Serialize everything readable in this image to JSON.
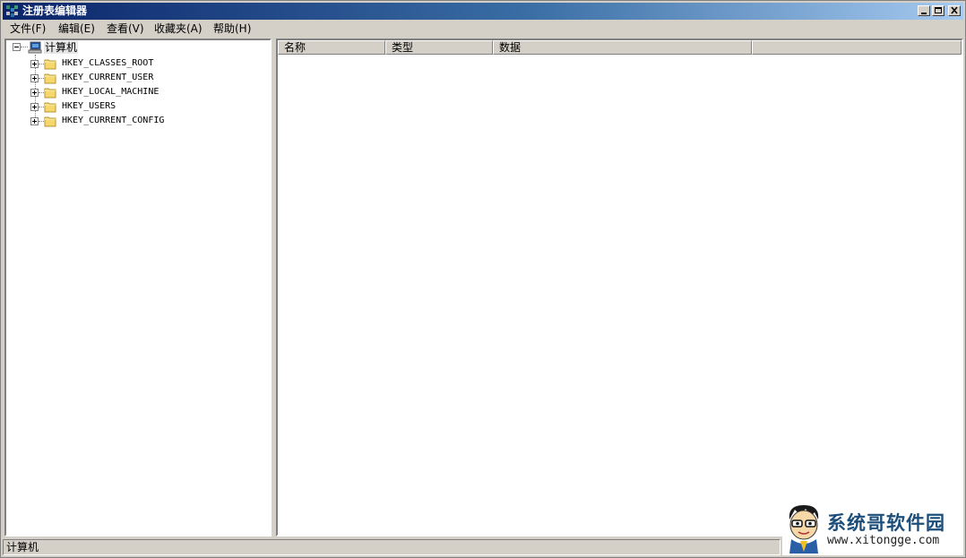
{
  "window": {
    "title": "注册表编辑器"
  },
  "menu": [
    {
      "label": "文件(F)"
    },
    {
      "label": "编辑(E)"
    },
    {
      "label": "查看(V)"
    },
    {
      "label": "收藏夹(A)"
    },
    {
      "label": "帮助(H)"
    }
  ],
  "tree": {
    "root": "计算机",
    "keys": [
      {
        "label": "HKEY_CLASSES_ROOT"
      },
      {
        "label": "HKEY_CURRENT_USER"
      },
      {
        "label": "HKEY_LOCAL_MACHINE"
      },
      {
        "label": "HKEY_USERS"
      },
      {
        "label": "HKEY_CURRENT_CONFIG"
      }
    ]
  },
  "list": {
    "columns": [
      {
        "label": "名称"
      },
      {
        "label": "类型"
      },
      {
        "label": "数据"
      }
    ]
  },
  "status": {
    "text": "计算机"
  },
  "watermark": {
    "title": "系统哥软件园",
    "url": "www.xitongge.com"
  },
  "colors": {
    "title_start": "#0a246a",
    "title_end": "#a6caf0",
    "folder": "#f5d76e"
  }
}
